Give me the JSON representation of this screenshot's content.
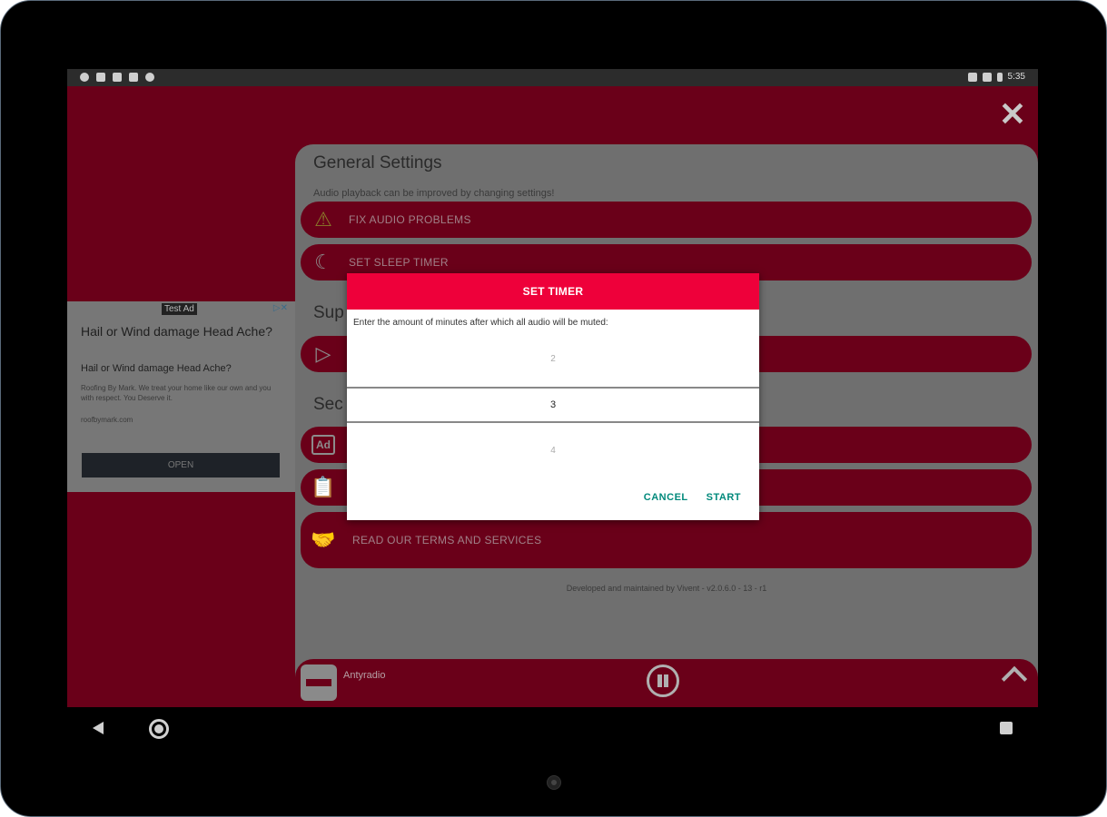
{
  "status_bar": {
    "time": "5:35"
  },
  "close_icon": "close-icon",
  "settings": {
    "title": "General Settings",
    "subtitle": "Audio playback can be improved by changing settings!",
    "buttons": [
      {
        "label": "FIX AUDIO PROBLEMS",
        "icon": "warning-icon"
      },
      {
        "label": "SET SLEEP TIMER",
        "icon": "moon-icon"
      }
    ],
    "support_heading": "Sup",
    "security_heading": "Sec",
    "terms_label": "READ OUR TERMS AND SERVICES",
    "footer": "Developed and maintained by Vivent - v2.0.6.0 - 13 - r1"
  },
  "ad": {
    "badge": "Test Ad",
    "headline": "Hail or Wind damage Head Ache?",
    "subheadline": "Hail or Wind damage Head Ache?",
    "body": "Roofing By Mark. We treat your home like our own and you with respect. You Deserve it.",
    "url": "roofbymark.com",
    "open_label": "OPEN"
  },
  "dialog": {
    "title": "SET TIMER",
    "message": "Enter the amount of minutes after which all audio will be muted:",
    "picker": {
      "prev": "2",
      "selected": "3",
      "next": "4"
    },
    "cancel_label": "CANCEL",
    "start_label": "START"
  },
  "player": {
    "station": "Antyradio"
  },
  "colors": {
    "accent": "#ee003a",
    "dark_red": "#6a0019",
    "dialog_action": "#00897b"
  }
}
